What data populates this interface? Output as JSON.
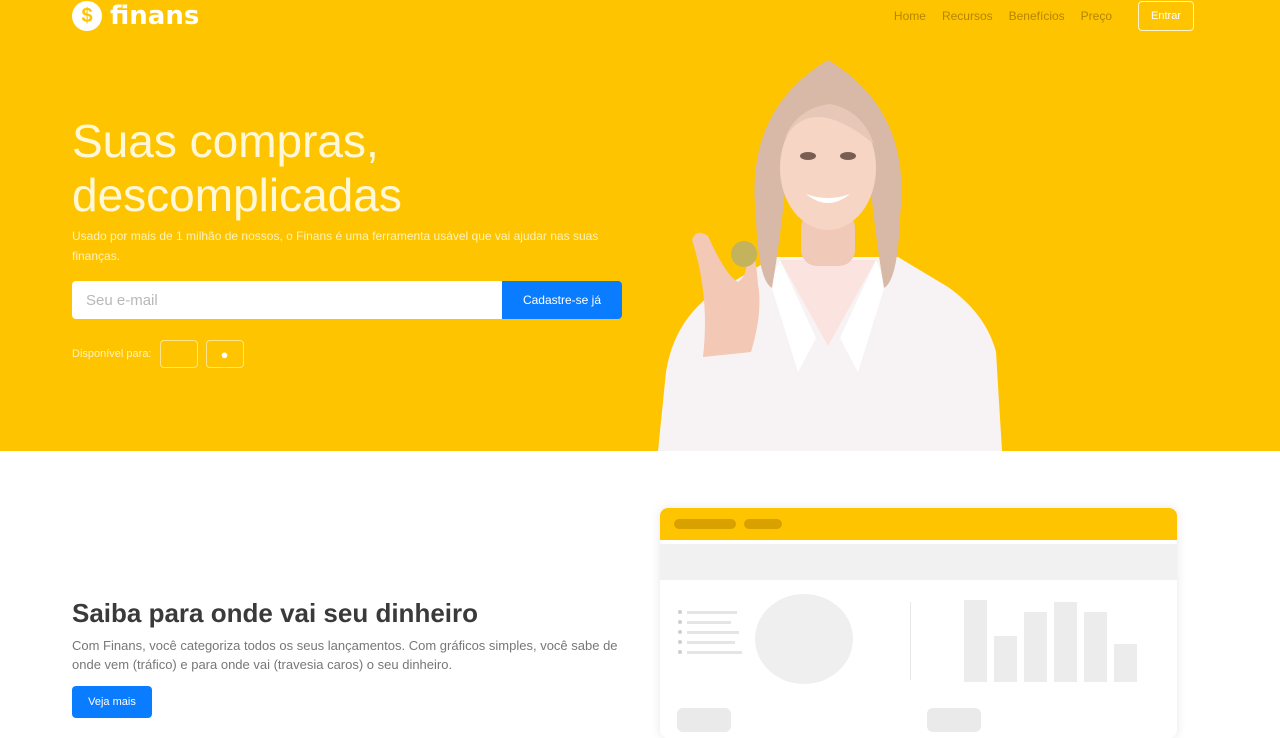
{
  "brand": {
    "name": "finans",
    "icon": "dollar-coin-icon",
    "icon_glyph": "$"
  },
  "nav": {
    "items": [
      "Home",
      "Recursos",
      "Benefícios",
      "Preço"
    ],
    "login_label": "Entrar"
  },
  "hero": {
    "title_line1": "Suas compras,",
    "title_line2": "descomplicadas",
    "subtitle": "Usado por mais de 1 milhão de nossos, o Finans é uma ferramenta usável que vai ajudar nas suas finanças.",
    "email_placeholder": "Seu e-mail",
    "signup_label": "Cadastre-se já",
    "available_label": "Disponível para:",
    "store_icons": [
      "apple-icon",
      "android-icon"
    ],
    "store_glyphs": [
      "",
      "●"
    ]
  },
  "section": {
    "title": "Saiba para onde vai seu dinheiro",
    "text": "Com Finans, você categoriza todos os seus lançamentos. Com gráficos simples, você sabe de onde vem (tráfico) e para onde vai (travesia caros) o seu dinheiro.",
    "cta_label": "Veja mais"
  },
  "colors": {
    "brand_yellow": "#ffc400",
    "accent_blue": "#0a7cff"
  }
}
